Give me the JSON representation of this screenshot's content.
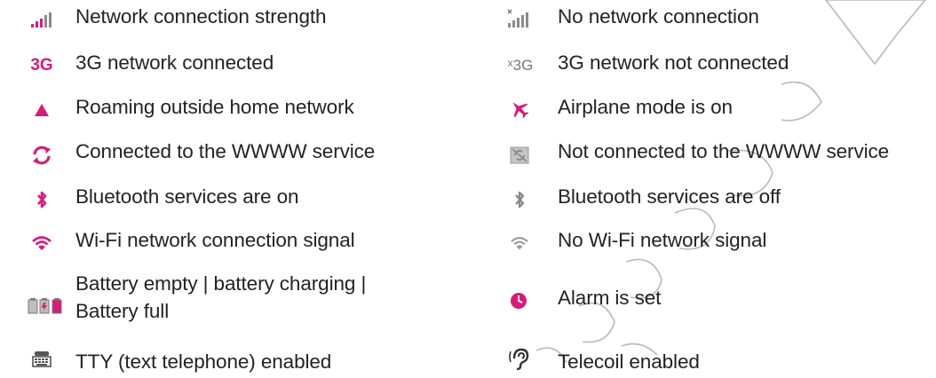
{
  "colors": {
    "accent": "#d81b7b",
    "icon_gray": "#8a8a8a",
    "text": "#222222",
    "watermark": "#9a9a9a"
  },
  "left": [
    {
      "icon": "signal-strength-icon",
      "label": "Network connection strength"
    },
    {
      "icon": "3g-icon",
      "icon_text": "3G",
      "label": "3G network connected"
    },
    {
      "icon": "roaming-triangle-icon",
      "label": "Roaming outside home network"
    },
    {
      "icon": "sync-arrows-icon",
      "label": "Connected to the WWWW service"
    },
    {
      "icon": "bluetooth-icon",
      "label": "Bluetooth services are on"
    },
    {
      "icon": "wifi-icon",
      "label": "Wi-Fi network connection signal"
    },
    {
      "icon": "battery-icon",
      "label_line1": "Battery empty | battery charging |",
      "label_line2": "Battery full"
    },
    {
      "icon": "tty-icon",
      "label": "TTY (text telephone) enabled"
    }
  ],
  "right": [
    {
      "icon": "no-signal-icon",
      "label": "No network connection"
    },
    {
      "icon": "3g-off-icon",
      "icon_text": "3G",
      "icon_prefix": "x",
      "label": "3G network not connected"
    },
    {
      "icon": "airplane-icon",
      "label": "Airplane mode is on"
    },
    {
      "icon": "sync-off-icon",
      "label": "Not connected to the WWWW service"
    },
    {
      "icon": "bluetooth-off-icon",
      "label": "Bluetooth services are off"
    },
    {
      "icon": "wifi-off-icon",
      "label": "No Wi-Fi network signal"
    },
    {
      "icon": "alarm-icon",
      "label": "Alarm is set"
    },
    {
      "icon": "telecoil-icon",
      "label": "Telecoil enabled"
    }
  ]
}
